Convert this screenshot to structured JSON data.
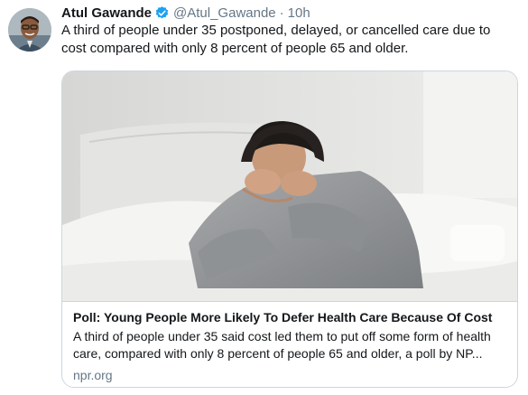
{
  "tweet": {
    "author_name": "Atul Gawande",
    "handle": "@Atul_Gawande",
    "separator": "·",
    "time": "10h",
    "text": "A third of people under 35 postponed, delayed, or cancelled care due to cost compared with only 8 percent of people 65 and older.",
    "verified": true
  },
  "card": {
    "title": "Poll: Young People More Likely To Defer Health Care Because Of Cost",
    "description": "A third of people under 35 said cost led them to put off some form of health care, compared with only 8 percent of people 65 and older, a poll by NP...",
    "domain": "npr.org",
    "image_subject": "man sitting on bed with head in hands"
  },
  "icons": {
    "verified": "verified-badge-icon"
  },
  "colors": {
    "text_primary": "#14171a",
    "text_secondary": "#657786",
    "verified_blue": "#1da1f2",
    "card_border": "#ccd6dd"
  }
}
